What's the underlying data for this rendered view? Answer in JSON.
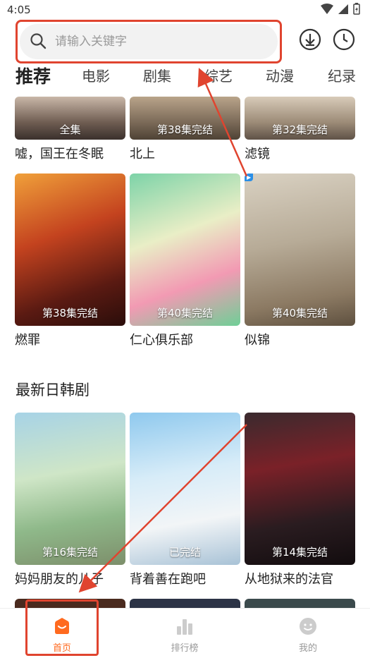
{
  "status": {
    "time": "4:05"
  },
  "search": {
    "placeholder": "请输入关键字"
  },
  "tabs": [
    {
      "label": "推荐",
      "active": true
    },
    {
      "label": "电影"
    },
    {
      "label": "剧集"
    },
    {
      "label": "综艺"
    },
    {
      "label": "动漫"
    },
    {
      "label": "纪录"
    }
  ],
  "grid_top": [
    {
      "title": "嘘，国王在冬眠",
      "badge": "全集"
    },
    {
      "title": "北上",
      "badge": "第38集完结"
    },
    {
      "title": "滤镜",
      "badge": "第32集完结"
    }
  ],
  "grid_mid": [
    {
      "title": "燃罪",
      "badge": "第38集完结"
    },
    {
      "title": "仁心俱乐部",
      "badge": "第40集完结"
    },
    {
      "title": "似锦",
      "badge": "第40集完结"
    }
  ],
  "section": {
    "title": "最新日韩剧"
  },
  "grid_jk": [
    {
      "title": "妈妈朋友的儿子",
      "badge": "第16集完结"
    },
    {
      "title": "背着善在跑吧",
      "badge": "已完结"
    },
    {
      "title": "从地狱来的法官",
      "badge": "第14集完结"
    }
  ],
  "nav": [
    {
      "label": "首页",
      "active": true
    },
    {
      "label": "排行榜"
    },
    {
      "label": "我的"
    }
  ],
  "colors": {
    "accent": "#ff6a1f",
    "annotation": "#e0442f"
  }
}
